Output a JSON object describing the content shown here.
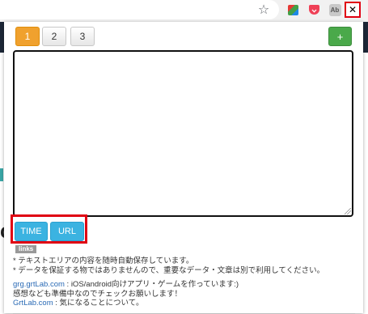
{
  "browser": {
    "star_icon": "star-icon",
    "extensions": [
      "gallery-extension-icon",
      "pocket-icon",
      "ab-extension-icon",
      "pen-extension-icon"
    ]
  },
  "pagination": {
    "pages": [
      "1",
      "2",
      "3"
    ],
    "active_page": "1",
    "add_label": "+"
  },
  "editor": {
    "text": ""
  },
  "actions": {
    "time_label": "TIME",
    "url_label": "URL"
  },
  "links_badge": "links",
  "notes": {
    "line1": "* テキストエリアの内容を随時自動保存しています。",
    "line2": "* データを保証する物ではありませんので、重要なデータ・文章は別で利用してください。",
    "line3_link": "grg.grtLab.com",
    "line3_text": " : iOS/android向けアプリ・ゲームを作っています:)",
    "line4": "感想なども準備中なのでチェックお願いします！",
    "line5_link": "GrtLab.com",
    "line5_text": " : 気になることについて。"
  },
  "colors": {
    "active_page": "#f0a12e",
    "add_button": "#4aa94a",
    "action_button": "#3bb3e1",
    "highlight": "#e00012"
  }
}
